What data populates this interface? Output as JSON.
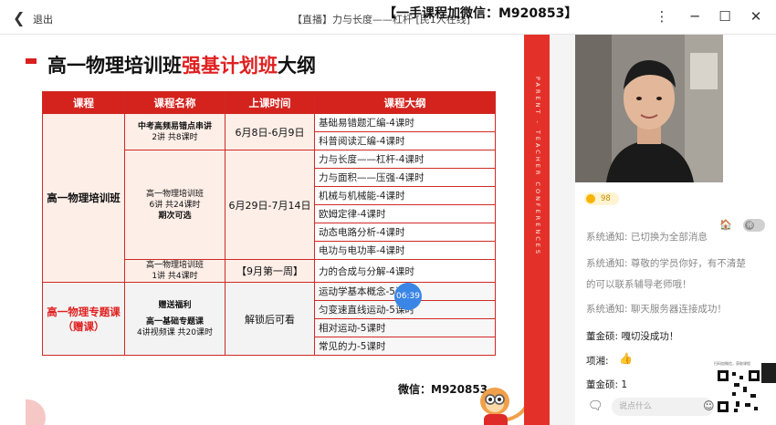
{
  "titlebar": {
    "exit_label": "退出",
    "title": "【直播】力与长度——杠杆 [民1人在线]",
    "watermark": "【一手课程加微信：M920853】"
  },
  "slide": {
    "title_part1": "高一物理培训班",
    "title_highlight": "强基计划班",
    "title_part2": "大纲",
    "side_strip_text": "PARENT - TEACHER CONFERENCES",
    "table": {
      "headers": [
        "课程",
        "课程名称",
        "上课时间",
        "课程大纲"
      ],
      "group1_course": "高一物理培训班",
      "group2_course_line1": "高一物理专题课",
      "group2_course_line2": "（赠课）",
      "rows": [
        {
          "name_line1": "中考高频易错点串讲",
          "name_line2": "2讲  共8课时",
          "time": "6月8日-6月9日",
          "outline": [
            "基础易错题汇编-4课时",
            "科普阅读汇编-4课时"
          ]
        },
        {
          "name_line1": "高一物理培训班",
          "name_line2": "6讲  共24课时",
          "name_line3": "期次可选",
          "time": "6月29日-7月14日",
          "outline": [
            "力与长度——杠杆-4课时",
            "力与面积——压强-4课时",
            "机械与机械能-4课时",
            "欧姆定律-4课时",
            "动态电路分析-4课时",
            "电功与电功率-4课时"
          ]
        },
        {
          "name_line1": "高一物理培训班",
          "name_line2": "1讲  共4课时",
          "time": "【9月第一周】",
          "outline": [
            "力的合成与分解-4课时"
          ]
        },
        {
          "name_line1": "赠送福利",
          "name_line2": "高一基础专题课",
          "name_line3": "4讲视频课  共20课时",
          "time": "解锁后可看",
          "outline": [
            "运动学基本概念-5课时",
            "匀变速直线运动-5课时",
            "相对运动-5课时",
            "常见的力-5课时"
          ]
        }
      ]
    },
    "timer": "06:39",
    "watermark2": "微信：M920853"
  },
  "chat": {
    "badge_value": "98",
    "toggle_label": "师",
    "messages": [
      {
        "text": "系统通知: 已切换为全部消息",
        "style": "system"
      },
      {
        "text": "系统通知: 尊敬的学员你好，有不清楚",
        "style": "system"
      },
      {
        "text": "的可以联系辅导老师哦！",
        "style": "system"
      },
      {
        "text": "系统通知: 聊天服务器连接成功！",
        "style": "system"
      },
      {
        "text": "董金硕: 嘎切没成功！",
        "style": "user"
      },
      {
        "text": "项湘:",
        "style": "user"
      },
      {
        "text": "董金硕: 1",
        "style": "user"
      }
    ],
    "input_placeholder": "说点什么",
    "qr_caption": "扫码加微信，获取课程"
  },
  "colors": {
    "accent_red": "#d4221c",
    "timer_blue": "#3a86e6",
    "badge_gold": "#f7b500"
  }
}
